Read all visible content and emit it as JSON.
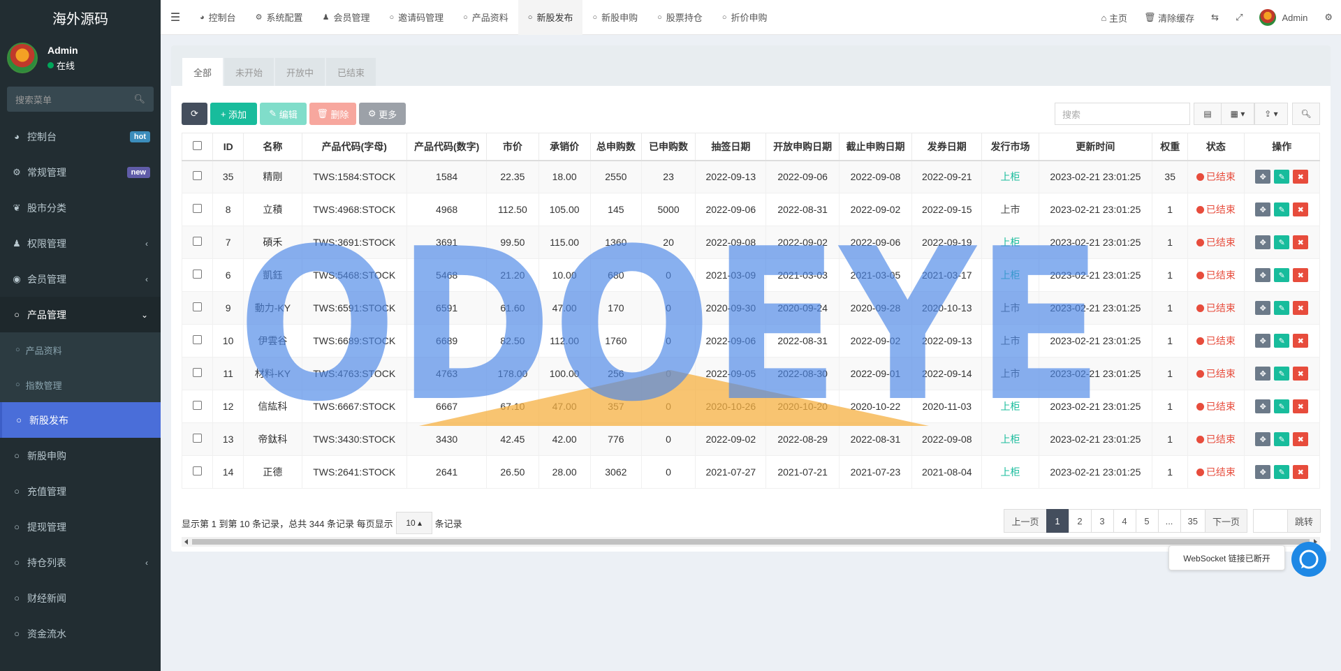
{
  "app": {
    "logo": "海外源码"
  },
  "user": {
    "name": "Admin",
    "status": "在线"
  },
  "sidebar": {
    "search_placeholder": "搜索菜单",
    "items": [
      {
        "label": "控制台",
        "icon": "dashboard-icon",
        "badge": "hot"
      },
      {
        "label": "常规管理",
        "icon": "cogs-icon",
        "badge": "new"
      },
      {
        "label": "股市分类",
        "icon": "leaf-icon"
      },
      {
        "label": "权限管理",
        "icon": "group-icon"
      },
      {
        "label": "会员管理",
        "icon": "user-circle-icon"
      },
      {
        "label": "产品管理",
        "icon": "circle-icon"
      },
      {
        "label": "新股发布",
        "icon": "circle-icon"
      },
      {
        "label": "新股申购",
        "icon": "circle-icon"
      },
      {
        "label": "充值管理",
        "icon": "circle-icon"
      },
      {
        "label": "提现管理",
        "icon": "circle-icon"
      },
      {
        "label": "持仓列表",
        "icon": "circle-icon"
      },
      {
        "label": "财经新闻",
        "icon": "circle-icon"
      },
      {
        "label": "资金流水",
        "icon": "circle-icon"
      }
    ],
    "subitems": [
      {
        "label": "产品资料"
      },
      {
        "label": "指数管理"
      }
    ]
  },
  "topnav": {
    "tabs": [
      "控制台",
      "系统配置",
      "会员管理",
      "邀请码管理",
      "产品资料",
      "新股发布",
      "新股申购",
      "股票持仓",
      "折价申购"
    ],
    "home": "主页",
    "clear_cache": "清除缓存",
    "admin": "Admin"
  },
  "filter_tabs": [
    "全部",
    "未开始",
    "开放中",
    "已结束"
  ],
  "toolbar": {
    "add": "添加",
    "edit": "编辑",
    "delete": "删除",
    "more": "更多",
    "search_placeholder": "搜索"
  },
  "table": {
    "headers": [
      "ID",
      "名称",
      "产品代码(字母)",
      "产品代码(数字)",
      "市价",
      "承销价",
      "总申购数",
      "已申购数",
      "抽签日期",
      "开放申购日期",
      "截止申购日期",
      "发券日期",
      "发行市场",
      "更新时间",
      "权重",
      "状态",
      "操作"
    ],
    "rows": [
      [
        "35",
        "精剛",
        "TWS:1584:STOCK",
        "1584",
        "22.35",
        "18.00",
        "2550",
        "23",
        "2022-09-13",
        "2022-09-06",
        "2022-09-08",
        "2022-09-21",
        "上柜",
        "2023-02-21 23:01:25",
        "35",
        "已结束"
      ],
      [
        "8",
        "立積",
        "TWS:4968:STOCK",
        "4968",
        "112.50",
        "105.00",
        "145",
        "5000",
        "2022-09-06",
        "2022-08-31",
        "2022-09-02",
        "2022-09-15",
        "上市",
        "2023-02-21 23:01:25",
        "1",
        "已结束"
      ],
      [
        "7",
        "碩禾",
        "TWS:3691:STOCK",
        "3691",
        "99.50",
        "115.00",
        "1360",
        "20",
        "2022-09-08",
        "2022-09-02",
        "2022-09-06",
        "2022-09-19",
        "上柜",
        "2023-02-21 23:01:25",
        "1",
        "已结束"
      ],
      [
        "6",
        "凱鈺",
        "TWS:5468:STOCK",
        "5468",
        "21.20",
        "10.00",
        "680",
        "0",
        "2021-03-09",
        "2021-03-03",
        "2021-03-05",
        "2021-03-17",
        "上柜",
        "2023-02-21 23:01:25",
        "1",
        "已结束"
      ],
      [
        "9",
        "動力-KY",
        "TWS:6591:STOCK",
        "6591",
        "61.60",
        "47.00",
        "170",
        "0",
        "2020-09-30",
        "2020-09-24",
        "2020-09-28",
        "2020-10-13",
        "上市",
        "2023-02-21 23:01:25",
        "1",
        "已结束"
      ],
      [
        "10",
        "伊雲谷",
        "TWS:6689:STOCK",
        "6689",
        "82.50",
        "112.00",
        "1760",
        "0",
        "2022-09-06",
        "2022-08-31",
        "2022-09-02",
        "2022-09-13",
        "上市",
        "2023-02-21 23:01:25",
        "1",
        "已结束"
      ],
      [
        "11",
        "材料-KY",
        "TWS:4763:STOCK",
        "4763",
        "178.00",
        "100.00",
        "256",
        "0",
        "2022-09-05",
        "2022-08-30",
        "2022-09-01",
        "2022-09-14",
        "上市",
        "2023-02-21 23:01:25",
        "1",
        "已结束"
      ],
      [
        "12",
        "信紘科",
        "TWS:6667:STOCK",
        "6667",
        "67.10",
        "47.00",
        "357",
        "0",
        "2020-10-26",
        "2020-10-20",
        "2020-10-22",
        "2020-11-03",
        "上柜",
        "2023-02-21 23:01:25",
        "1",
        "已结束"
      ],
      [
        "13",
        "帝鈦科",
        "TWS:3430:STOCK",
        "3430",
        "42.45",
        "42.00",
        "776",
        "0",
        "2022-09-02",
        "2022-08-29",
        "2022-08-31",
        "2022-09-08",
        "上柜",
        "2023-02-21 23:01:25",
        "1",
        "已结束"
      ],
      [
        "14",
        "正德",
        "TWS:2641:STOCK",
        "2641",
        "26.50",
        "28.00",
        "3062",
        "0",
        "2021-07-27",
        "2021-07-21",
        "2021-07-23",
        "2021-08-04",
        "上柜",
        "2023-02-21 23:01:25",
        "1",
        "已结束"
      ]
    ]
  },
  "pager": {
    "info_prefix": "显示第 1 到第 10 条记录，总共 344 条记录 每页显示",
    "page_size": "10",
    "info_suffix": "条记录",
    "prev": "上一页",
    "next": "下一页",
    "pages": [
      "1",
      "2",
      "3",
      "4",
      "5",
      "...",
      "35"
    ],
    "jump": "跳转"
  },
  "watermark": "ODOEYE",
  "toast": "WebSocket 链接已断开",
  "colors": {
    "sidebar_bg": "#222d32",
    "active_menu": "#4a6ed9",
    "success": "#18bc9c",
    "danger": "#e74c3c"
  }
}
